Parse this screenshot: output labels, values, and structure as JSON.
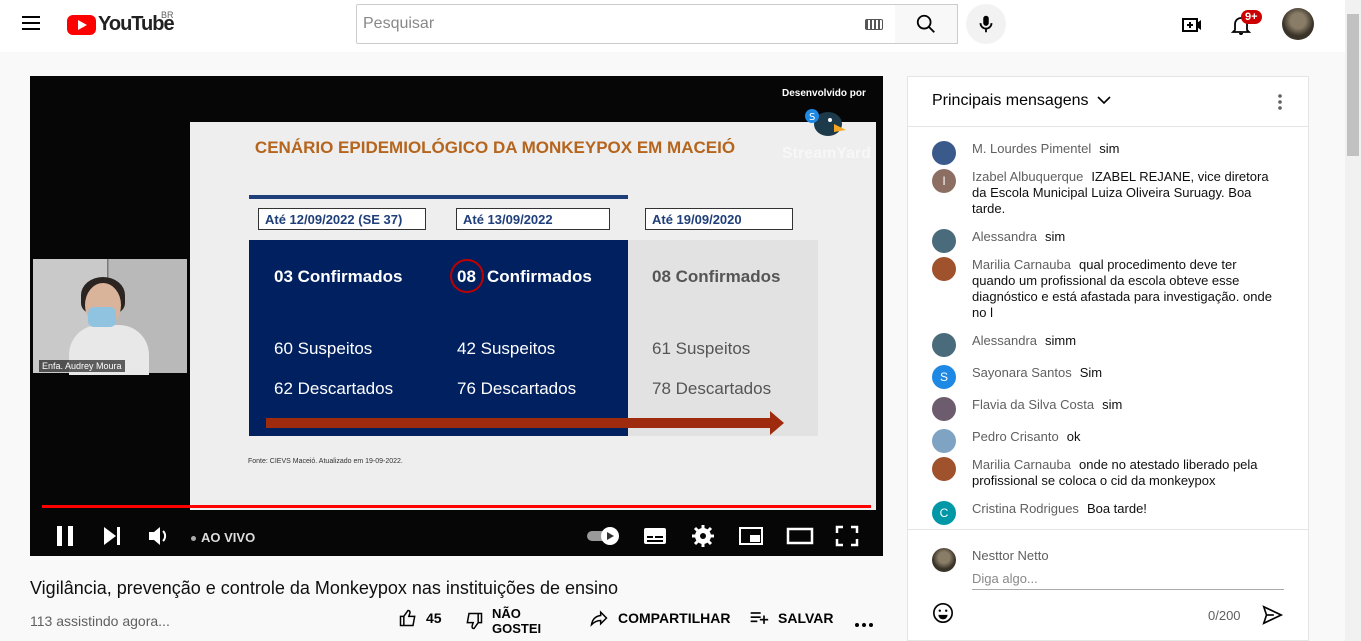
{
  "topbar": {
    "logo_text": "YouTube",
    "country_code": "BR",
    "search_placeholder": "Pesquisar",
    "notifications_count": "9+"
  },
  "video": {
    "slide": {
      "title": "CENÁRIO EPIDEMIOLÓGICO DA MONKEYPOX EM MACEIÓ",
      "columns": [
        {
          "date": "Até 12/09/2022 (SE 37)",
          "confirmed": "03 Confirmados",
          "suspected": "60 Suspeitos",
          "discarded": "62 Descartados"
        },
        {
          "date": "Até 13/09/2022",
          "confirmed_num": "08",
          "confirmed_label": "Confirmados",
          "suspected": "42 Suspeitos",
          "discarded": "76 Descartados"
        },
        {
          "date": "Até 19/09/2020",
          "confirmed": "08 Confirmados",
          "suspected": "61 Suspeitos",
          "discarded": "78 Descartados"
        }
      ],
      "source": "Fonte: CIEVS Maceió. Atualizado em 19-09-2022."
    },
    "credit": "Desenvolvido por",
    "brand": "StreamYard",
    "camera_label": "Enfa. Audrey Moura",
    "live_label": "AO VIVO"
  },
  "info": {
    "title": "Vigilância, prevenção e controle da Monkeypox nas instituições de ensino",
    "watching": "113 assistindo agora...",
    "likes": "45",
    "dislike_line1": "NÃO",
    "dislike_line2": "GOSTEI",
    "share": "COMPARTILHAR",
    "save": "SALVAR"
  },
  "chat": {
    "header": "Principais mensagens",
    "messages": [
      {
        "author": "M. Lourdes Pimentel",
        "text": "sim",
        "avatar_color": "#3b5a8c",
        "initial": ""
      },
      {
        "author": "Izabel Albuquerque",
        "text": "IZABEL REJANE, vice diretora da Escola Municipal Luiza Oliveira Suruagy. Boa tarde.",
        "avatar_color": "#8d6e63",
        "initial": "I"
      },
      {
        "author": "Alessandra",
        "text": "sim",
        "avatar_color": "#4a6b7c",
        "initial": ""
      },
      {
        "author": "Marilia Carnauba",
        "text": "qual procedimento deve ter quando um profissional da escola obteve esse diagnóstico e está afastada para investigação. onde no l",
        "avatar_color": "#a0522d",
        "initial": ""
      },
      {
        "author": "Alessandra",
        "text": "simm",
        "avatar_color": "#4a6b7c",
        "initial": ""
      },
      {
        "author": "Sayonara Santos",
        "text": "Sim",
        "avatar_color": "#1e88e5",
        "initial": "S"
      },
      {
        "author": "Flavia da Silva Costa",
        "text": "sim",
        "avatar_color": "#6d5b6e",
        "initial": ""
      },
      {
        "author": "Pedro Crisanto",
        "text": "ok",
        "avatar_color": "#7fa3c2",
        "initial": ""
      },
      {
        "author": "Marilia Carnauba",
        "text": "onde no atestado liberado pela profissional se coloca o cid da monkeypox",
        "avatar_color": "#a0522d",
        "initial": ""
      },
      {
        "author": "Cristina Rodrigues",
        "text": "Boa tarde!",
        "avatar_color": "#0097a7",
        "initial": "C"
      }
    ],
    "me_name": "Nesttor Netto",
    "input_placeholder": "Diga algo...",
    "counter": "0/200"
  }
}
